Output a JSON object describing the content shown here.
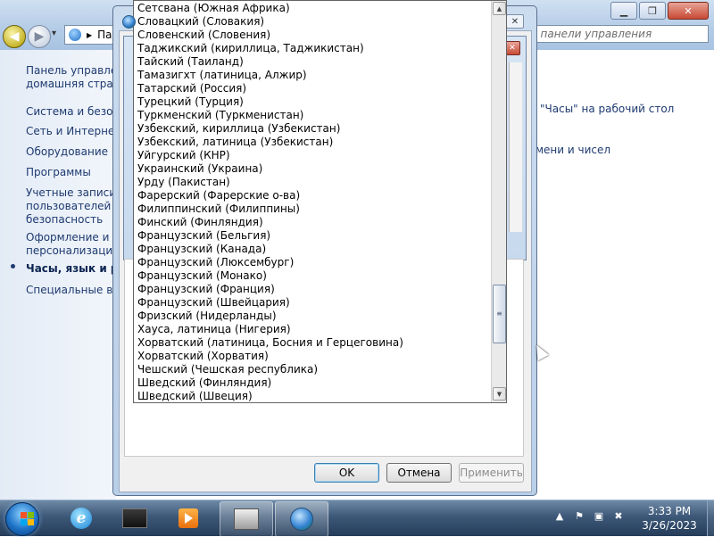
{
  "control_panel": {
    "breadcrumb_text": "Па",
    "search_placeholder": "ск в панели управления",
    "sidebar": {
      "home_line1": "Панель управлен",
      "home_line2": "домашняя страни",
      "items": [
        "Система и безопа",
        "Сеть и Интернет",
        "Оборудование и з",
        "Программы",
        "Учетные записи",
        "пользователей и",
        "безопасность",
        "Оформление и",
        "персонализация",
        "Часы, язык и ре",
        "Специальные воз"
      ]
    },
    "link_clocks": "\"Часы\" на рабочий стол",
    "link_time_numbers": "мени и чисел"
  },
  "dropdown": {
    "items": [
      "Сетсвана (Южная Африка)",
      "Словацкий (Словакия)",
      "Словенский (Словения)",
      "Таджикский (кириллица, Таджикистан)",
      "Тайский (Таиланд)",
      "Тамазигхт (латиница, Алжир)",
      "Татарский (Россия)",
      "Турецкий (Турция)",
      "Туркменский (Туркменистан)",
      "Узбекский, кириллица (Узбекистан)",
      "Узбекский, латиница (Узбекистан)",
      "Уйгурский (КНР)",
      "Украинский (Украина)",
      "Урду (Пакистан)",
      "Фарерский (Фарерские о-ва)",
      "Филиппинский (Филиппины)",
      "Финский (Финляндия)",
      "Французский (Бельгия)",
      "Французский (Канада)",
      "Французский (Люксембург)",
      "Французский (Монако)",
      "Французский (Франция)",
      "Французский (Швейцария)",
      "Фризский (Нидерланды)",
      "Хауса, латиница (Нигерия)",
      "Хорватский (латиница, Босния и Герцеговина)",
      "Хорватский (Хорватия)",
      "Чешский (Чешская республика)",
      "Шведский (Финляндия)",
      "Шведский (Швеция)"
    ],
    "scroll_position": 0.86
  },
  "dialog": {
    "ok_label": "OK",
    "cancel_label": "Отмена",
    "apply_label": "Применить",
    "close_glyph": "✕"
  },
  "taskbar": {
    "clock_time": "3:33 PM",
    "clock_date": "3/26/2023"
  },
  "colors": {
    "link": "#1e3a70",
    "taskbar": "#3d5878",
    "close_red": "#c74a35"
  },
  "icons": [
    "back-arrow-icon",
    "forward-arrow-icon",
    "control-panel-icon",
    "globe-icon",
    "windows-start-icon",
    "internet-explorer-icon",
    "media-player-icon",
    "flag-icon",
    "network-icon",
    "volume-muted-icon"
  ]
}
